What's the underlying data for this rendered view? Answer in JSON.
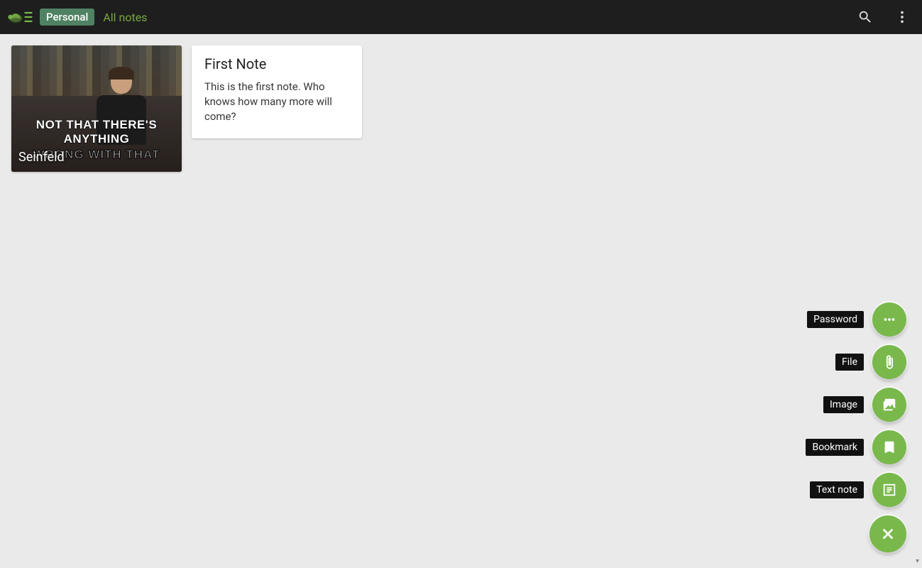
{
  "header": {
    "space": "Personal",
    "breadcrumb": "All notes"
  },
  "notes": {
    "imageCard": {
      "title": "Seinfeld",
      "memeLine1": "NOT THAT THERE'S ANYTHING",
      "memeLine2": "WRONG WITH THAT"
    },
    "textCard": {
      "title": "First Note",
      "body": "This is the first note. Who knows how many more will come?"
    }
  },
  "fab": {
    "password": "Password",
    "file": "File",
    "image": "Image",
    "bookmark": "Bookmark",
    "textnote": "Text note"
  }
}
